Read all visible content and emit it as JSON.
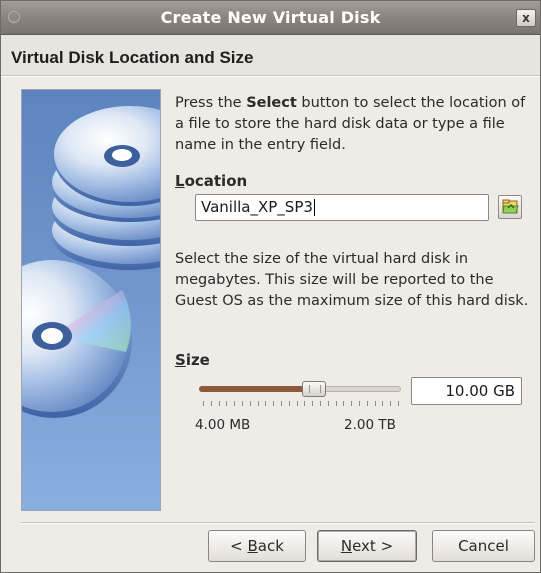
{
  "window": {
    "title": "Create New Virtual Disk",
    "close_label": "x"
  },
  "header": {
    "title": "Virtual Disk Location and Size"
  },
  "intro": {
    "before": "Press the ",
    "bold": "Select",
    "after": " button to select the location of a file to store the hard disk data or type a file name in the entry field."
  },
  "location": {
    "label_mnemonic": "L",
    "label_rest": "ocation",
    "value": "Vanilla_XP_SP3",
    "folder_icon": "folder-open-icon"
  },
  "size": {
    "description": "Select the size of the virtual hard disk in megabytes. This size will be reported to the Guest OS as the maximum size of this hard disk.",
    "label_mnemonic": "S",
    "label_rest": "ize",
    "value": "10.00 GB",
    "slider_fraction": 0.57,
    "range_min": "4.00 MB",
    "range_max": "2.00 TB"
  },
  "buttons": {
    "back_prefix": "< ",
    "back_mnemonic": "B",
    "back_rest": "ack",
    "next_mnemonic": "N",
    "next_rest": "ext >",
    "cancel": "Cancel"
  },
  "colors": {
    "slider_fill": "#8b5a3c",
    "side_panel": "#6d93ca"
  }
}
